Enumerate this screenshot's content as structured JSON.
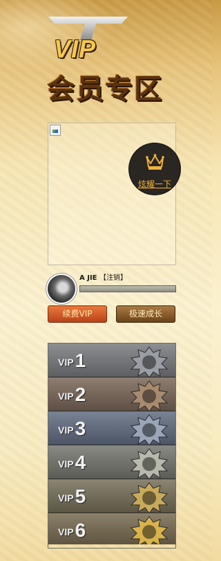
{
  "header": {
    "logo_text": "VIP",
    "title": "会员专区"
  },
  "show_off": {
    "label": "炫耀一下",
    "icon": "crown-icon"
  },
  "user": {
    "name": "A JIE",
    "logout_label": "【注销】",
    "xp_progress": 0.0
  },
  "actions": {
    "renew_label": "续费VIP",
    "grow_label": "极速成长"
  },
  "levels": [
    {
      "prefix": "VIP",
      "number": "1",
      "color_top": "#8d8f92",
      "color_bottom": "#5d5f62",
      "badge": "#9a9ea4"
    },
    {
      "prefix": "VIP",
      "number": "2",
      "color_top": "#8f7f72",
      "color_bottom": "#5e4f44",
      "badge": "#a88a6e"
    },
    {
      "prefix": "VIP",
      "number": "3",
      "color_top": "#7a8394",
      "color_bottom": "#4c5566",
      "badge": "#9aa6b8"
    },
    {
      "prefix": "VIP",
      "number": "4",
      "color_top": "#8a8a84",
      "color_bottom": "#5c5c56",
      "badge": "#b8b8ac"
    },
    {
      "prefix": "VIP",
      "number": "5",
      "color_top": "#8a8472",
      "color_bottom": "#5c5644",
      "badge": "#c9a95a"
    },
    {
      "prefix": "VIP",
      "number": "6",
      "color_top": "#8c826a",
      "color_bottom": "#5e5440",
      "badge": "#d9b24a"
    }
  ]
}
